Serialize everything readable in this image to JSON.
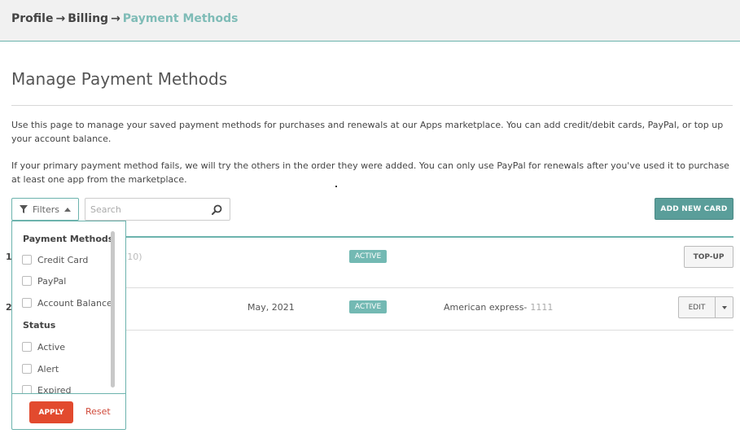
{
  "breadcrumb": {
    "items": [
      "Profile",
      "Billing",
      "Payment Methods"
    ],
    "separator": "→"
  },
  "page": {
    "title": "Manage Payment Methods",
    "intro_1": "Use this page to manage your saved payment methods for purchases and renewals at our Apps marketplace. You can add credit/debit cards, PayPal, or top up your account balance.",
    "intro_2": "If your primary payment method fails, we will try the others in the order they were added. You can only use PayPal for renewals after you've used it to purchase at least one app from the marketplace."
  },
  "toolbar": {
    "filters_label": "Filters",
    "search_placeholder": "Search",
    "add_card_label": "ADD NEW CARD"
  },
  "filter_panel": {
    "groups": [
      {
        "title": "Payment Methods",
        "options": [
          "Credit Card",
          "PayPal",
          "Account Balance"
        ]
      },
      {
        "title": "Status",
        "options": [
          "Active",
          "Alert",
          "Expired"
        ]
      }
    ],
    "apply_label": "APPLY",
    "reset_label": "Reset"
  },
  "rows": [
    {
      "num": "1",
      "faint": "(10)",
      "status": "ACTIVE",
      "action": "TOP-UP"
    },
    {
      "num": "2",
      "date": "May, 2021",
      "status": "ACTIVE",
      "card_type": "American express-",
      "card_digits": "1111",
      "action": "EDIT"
    }
  ],
  "colors": {
    "accent": "#6cb3ad",
    "badge": "#73b9b3",
    "add_button": "#5a9e9a",
    "apply_button": "#e24a2e",
    "reset_link": "#d04a3a"
  },
  "icons": {
    "filter": "funnel-icon",
    "filter_caret": "caret-up-icon",
    "search": "magnifier-icon",
    "edit_menu": "caret-down-icon"
  }
}
